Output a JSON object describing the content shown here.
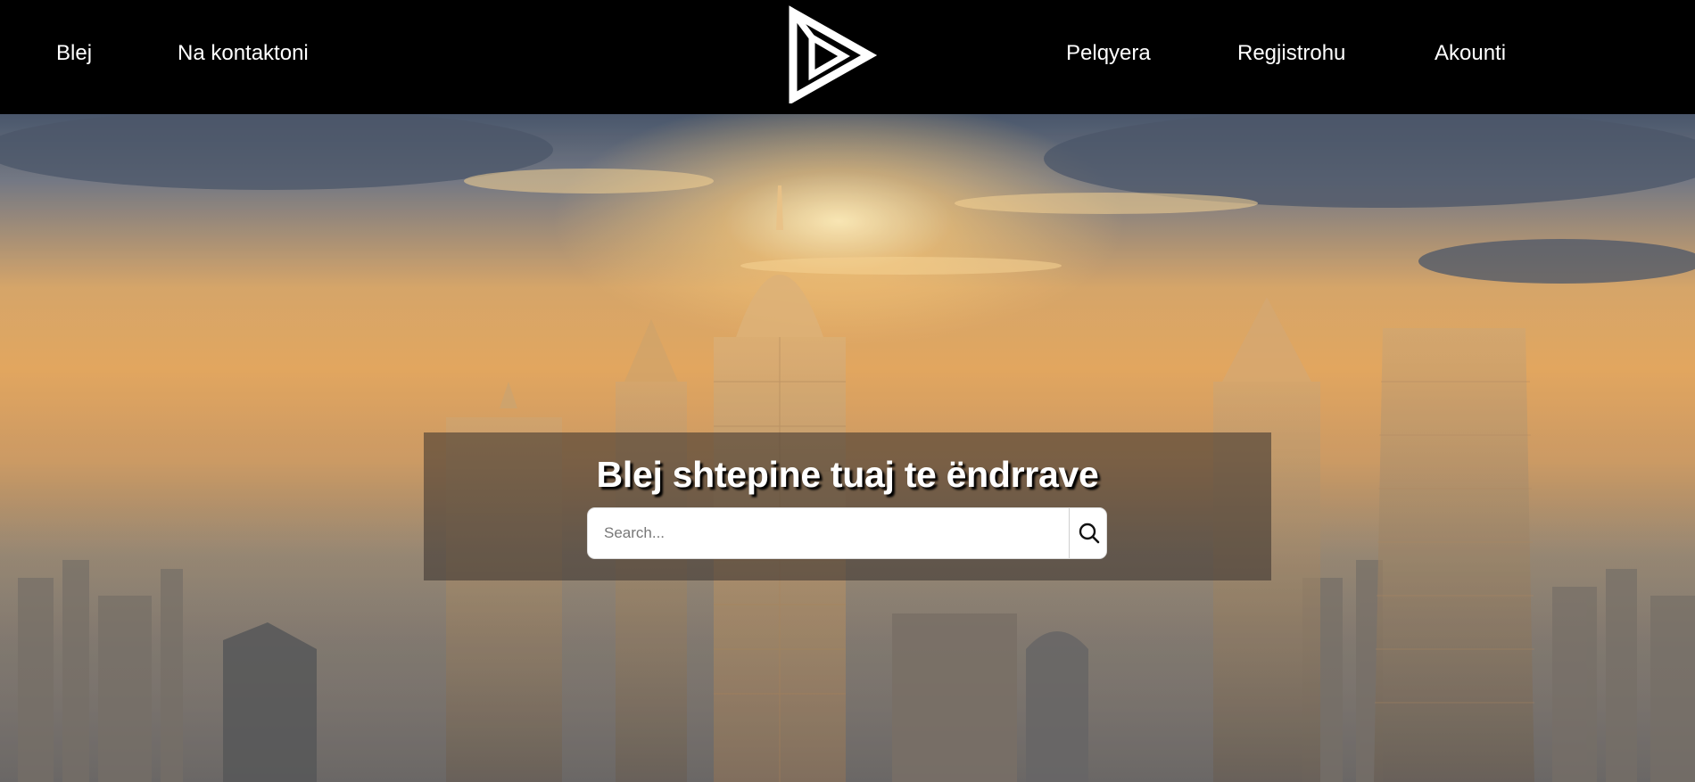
{
  "header": {
    "nav_left": [
      {
        "label": "Blej"
      },
      {
        "label": "Na kontaktoni"
      }
    ],
    "nav_right": [
      {
        "label": "Pelqyera"
      },
      {
        "label": "Regjistrohu"
      },
      {
        "label": "Akounti"
      }
    ],
    "logo_icon": "triangle-play-logo"
  },
  "hero": {
    "title": "Blej shtepine tuaj te ëndrrave",
    "search": {
      "placeholder": "Search...",
      "value": "",
      "button_icon": "search-icon"
    },
    "background": "city-skyline-sunset-photo"
  },
  "colors": {
    "header_bg": "#000000",
    "nav_text": "#ffffff",
    "title_text": "#ffffff",
    "search_bg": "#ffffff"
  }
}
